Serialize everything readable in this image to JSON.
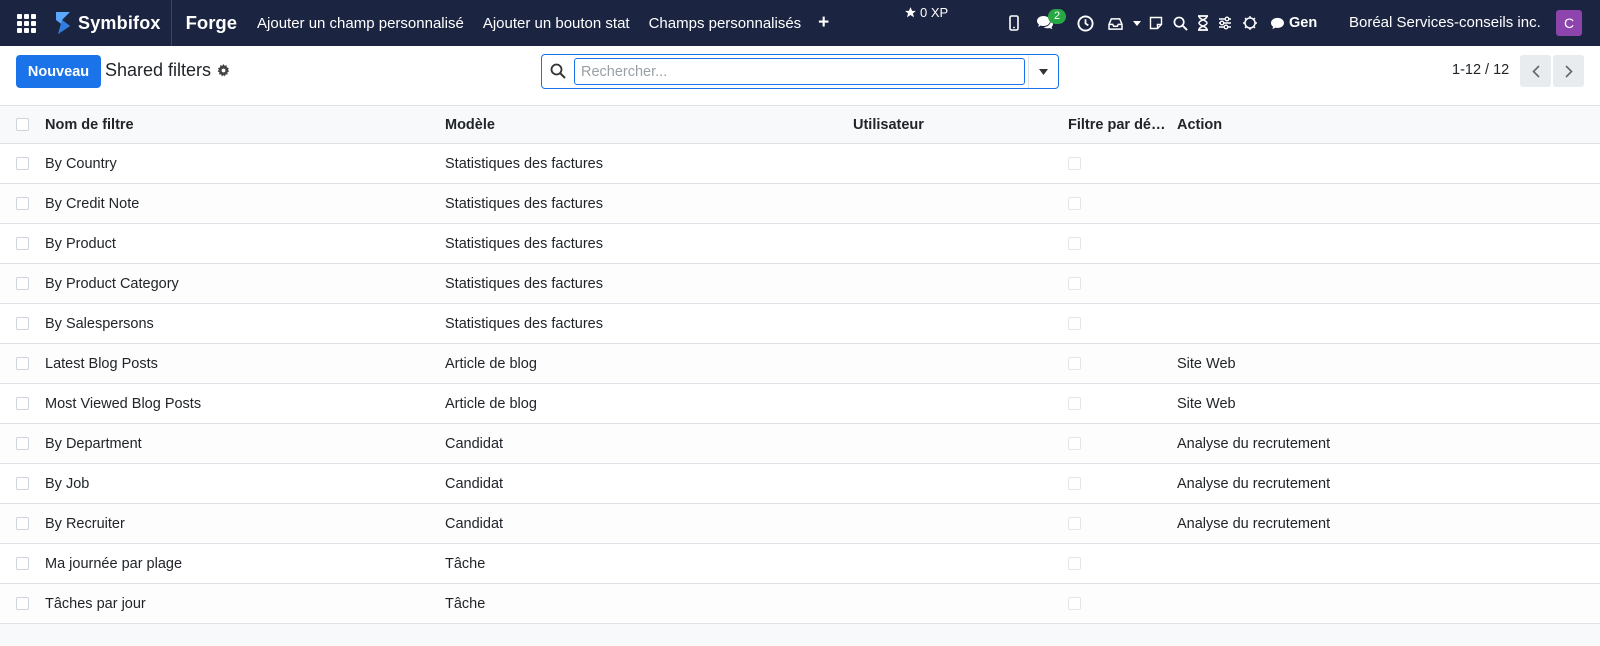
{
  "navbar": {
    "logo_text": "Symbifox",
    "app_name": "Forge",
    "menu": [
      {
        "label": "Ajouter un champ personnalisé"
      },
      {
        "label": "Ajouter un bouton stat"
      },
      {
        "label": "Champs personnalisés"
      }
    ],
    "xp_label": "0 XP",
    "messages_badge": "2",
    "gen_label": "Gen",
    "company": "Boréal Services-conseils inc.",
    "avatar_letter": "C"
  },
  "control_panel": {
    "new_button": "Nouveau",
    "title": "Shared filters",
    "search_placeholder": "Rechercher...",
    "pager": "1-12 / 12"
  },
  "list": {
    "columns": {
      "name": "Nom de filtre",
      "model": "Modèle",
      "user": "Utilisateur",
      "default": "Filtre par dé…",
      "action": "Action"
    },
    "rows": [
      {
        "name": "By Country",
        "model": "Statistiques des factures",
        "user": "",
        "action": ""
      },
      {
        "name": "By Credit Note",
        "model": "Statistiques des factures",
        "user": "",
        "action": ""
      },
      {
        "name": "By Product",
        "model": "Statistiques des factures",
        "user": "",
        "action": ""
      },
      {
        "name": "By Product Category",
        "model": "Statistiques des factures",
        "user": "",
        "action": ""
      },
      {
        "name": "By Salespersons",
        "model": "Statistiques des factures",
        "user": "",
        "action": ""
      },
      {
        "name": "Latest Blog Posts",
        "model": "Article de blog",
        "user": "",
        "action": "Site Web"
      },
      {
        "name": "Most Viewed Blog Posts",
        "model": "Article de blog",
        "user": "",
        "action": "Site Web"
      },
      {
        "name": "By Department",
        "model": "Candidat",
        "user": "",
        "action": "Analyse du recrutement"
      },
      {
        "name": "By Job",
        "model": "Candidat",
        "user": "",
        "action": "Analyse du recrutement"
      },
      {
        "name": "By Recruiter",
        "model": "Candidat",
        "user": "",
        "action": "Analyse du recrutement"
      },
      {
        "name": "Ma journée par plage",
        "model": "Tâche",
        "user": "",
        "action": ""
      },
      {
        "name": "Tâches par jour",
        "model": "Tâche",
        "user": "",
        "action": ""
      }
    ]
  },
  "colors": {
    "navbar_bg": "#1b2541",
    "primary": "#1a73e8",
    "badge": "#28a745",
    "avatar": "#8e44ad"
  }
}
